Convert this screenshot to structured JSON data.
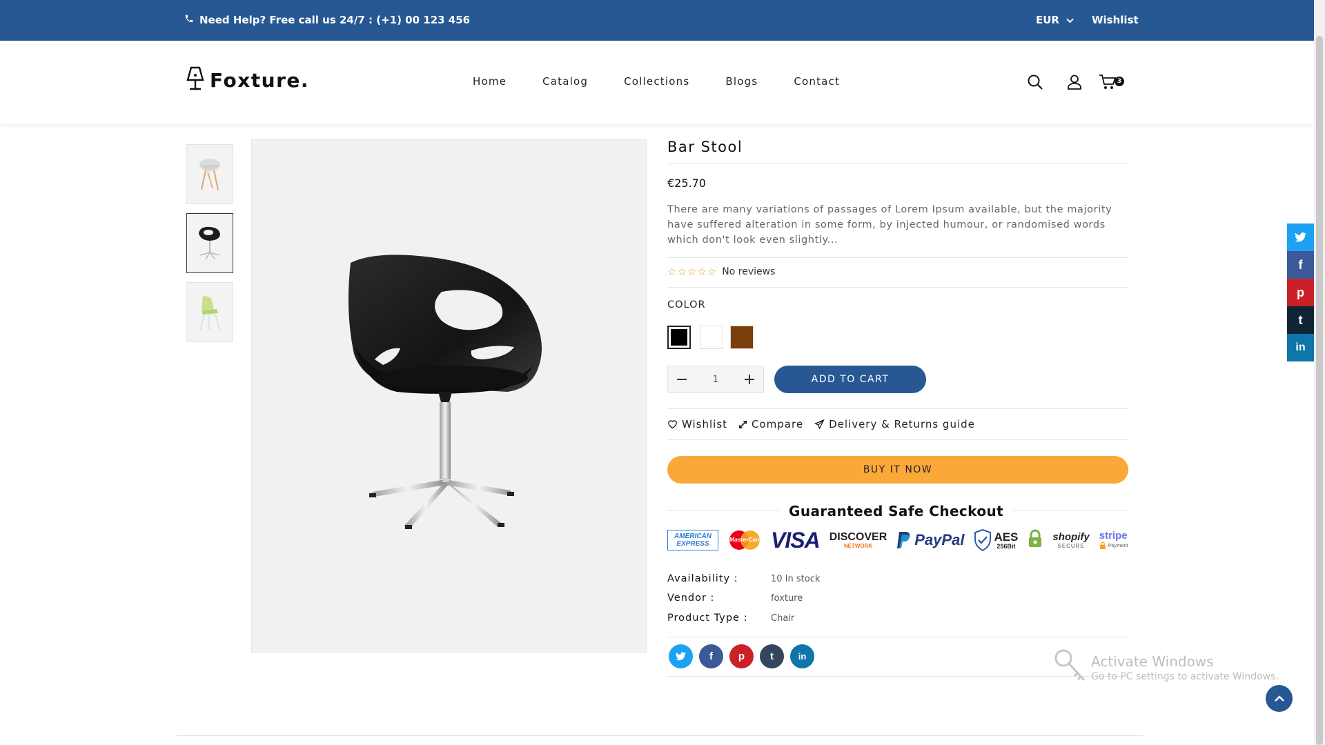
{
  "topbar": {
    "help_text": "Need Help? Free call us 24/7 : (+1) 00 123 456",
    "currency": "EUR",
    "wishlist": "Wishlist"
  },
  "header": {
    "logo_text": "Foxture.",
    "nav": [
      "Home",
      "Catalog",
      "Collections",
      "Blogs",
      "Contact"
    ],
    "cart_count": "3"
  },
  "product": {
    "title": "Bar Stool",
    "price": "€25.70",
    "description": "There are many variations of passages of Lorem Ipsum available, but the majority have suffered alteration in some form, by injected humour, or randomised words which don't look even slightly...",
    "reviews": "No reviews",
    "color_label": "COLOR",
    "swatch_colors": [
      "#000000",
      "#ffffff",
      "#7a3f0a"
    ],
    "quantity": "1",
    "add_to_cart": "ADD TO CART",
    "actions": {
      "wishlist": "Wishlist",
      "compare": "Compare",
      "delivery": "Delivery & Returns guide"
    },
    "buy_now": "BUY IT NOW",
    "safe_checkout": "Guaranteed Safe Checkout",
    "payments": {
      "amex_1": "AMERICAN",
      "amex_2": "EXPRESS",
      "mastercard": "MasterCard",
      "visa": "VISA",
      "discover": "DISCOVER",
      "discover_sub": "NETWORK",
      "paypal": "PayPal",
      "aes": "AES",
      "aes_sub": "256Bit",
      "shopify": "shopify",
      "shopify_sub": "SECURE",
      "stripe": "stripe",
      "stripe_sub": "Payment"
    },
    "meta": {
      "availability_label": "Availability :",
      "availability": "10 In stock",
      "vendor_label": "Vendor :",
      "vendor": "foxture",
      "type_label": "Product Type :",
      "type": "Chair"
    }
  },
  "social_colors": {
    "twitter": "#1da1f2",
    "facebook": "#3b5998",
    "pinterest": "#cb2027",
    "tumblr": "#34465d",
    "linkedin": "#0e76a8"
  },
  "windows_notice": {
    "title": "Activate Windows",
    "subtitle": "Go to PC settings to activate Windows."
  }
}
